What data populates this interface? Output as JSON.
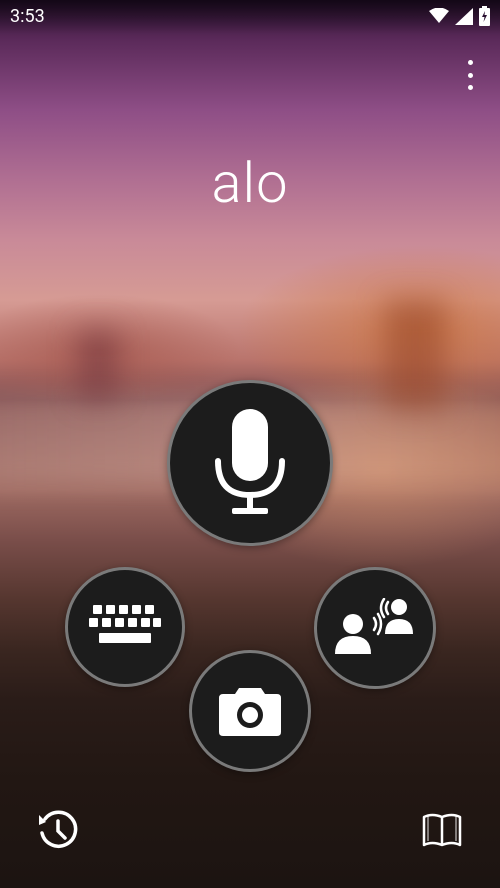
{
  "status_bar": {
    "time": "3:53",
    "icons": [
      "wifi-icon",
      "signal-icon",
      "battery-charging-icon"
    ]
  },
  "toolbar": {
    "overflow_icon": "overflow-menu-icon"
  },
  "main": {
    "recognized_text": "alo"
  },
  "actions": {
    "voice": {
      "icon": "microphone-icon"
    },
    "keyboard": {
      "icon": "keyboard-icon"
    },
    "camera": {
      "icon": "camera-icon"
    },
    "conversation": {
      "icon": "conversation-icon"
    }
  },
  "bottom_bar": {
    "history_icon": "history-icon",
    "phrasebook_icon": "phrasebook-icon"
  },
  "colors": {
    "button_fill": "#1c1c1c",
    "icon_color": "#ffffff"
  }
}
